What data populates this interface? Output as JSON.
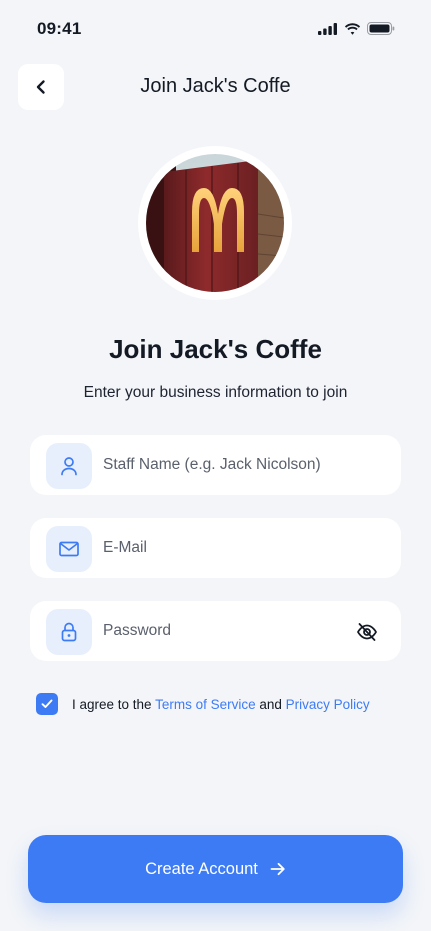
{
  "status_bar": {
    "time": "09:41"
  },
  "header": {
    "title": "Join Jack's Coffe"
  },
  "main": {
    "title": "Join Jack's Coffe",
    "subtitle": "Enter your business information to join"
  },
  "form": {
    "name_placeholder": "Staff Name (e.g. Jack Nicolson)",
    "email_placeholder": "E-Mail",
    "password_placeholder": "Password"
  },
  "agreement": {
    "checked": true,
    "prefix": "I agree to the ",
    "terms_label": "Terms of Service",
    "middle": " and ",
    "privacy_label": "Privacy Policy"
  },
  "cta": {
    "label": "Create Account"
  },
  "icons": {
    "back": "chevron-left-icon",
    "user": "user-icon",
    "mail": "mail-icon",
    "lock": "lock-icon",
    "eye": "eye-off-icon",
    "check": "check-icon",
    "arrow": "arrow-right-icon"
  },
  "colors": {
    "background": "#f3f5f8",
    "accent": "#3d7bf5",
    "icon_bg": "#e7effc",
    "text": "#141a24"
  }
}
